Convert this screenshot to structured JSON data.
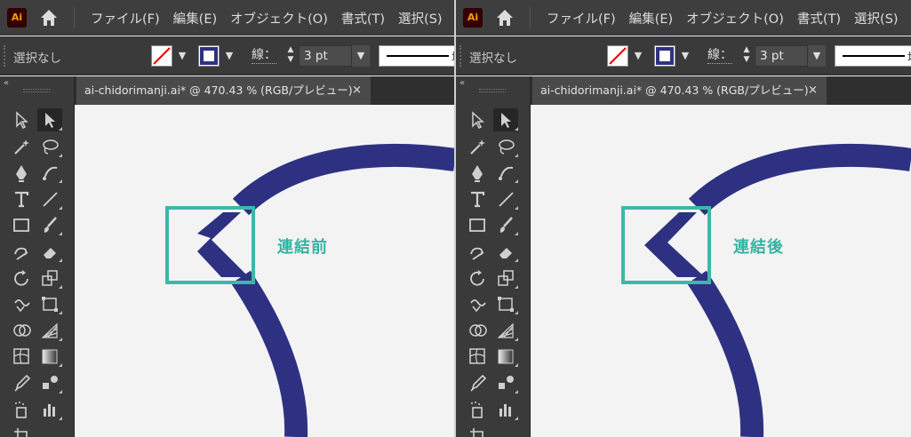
{
  "app": {
    "logo_text": "Ai"
  },
  "menu": [
    "ファイル(F)",
    "編集(E)",
    "オブジェクト(O)",
    "書式(T)",
    "選択(S)"
  ],
  "control": {
    "selection_label": "選択なし",
    "stroke_label": "線：",
    "stroke_weight": "3 pt",
    "profile_label": "均"
  },
  "document": {
    "tab_title": "ai-chidorimanji.ai* @ 470.43 % (RGB/プレビュー)",
    "close": "×"
  },
  "tools": [
    "direct-selection",
    "selection",
    "magic-wand",
    "lasso",
    "pen",
    "curvature",
    "type",
    "line-segment",
    "rectangle",
    "paintbrush",
    "shaper",
    "eraser",
    "rotate",
    "scale",
    "warp",
    "free-transform",
    "shape-builder",
    "perspective-grid",
    "mesh",
    "gradient",
    "eyedropper",
    "blend",
    "symbol-sprayer",
    "column-graph",
    "artboard"
  ],
  "colors": {
    "shape": "#2e3182",
    "highlight": "#3db7a8",
    "label": "#36b3a3"
  },
  "panels": [
    {
      "label": "連結前",
      "state": "before"
    },
    {
      "label": "連結後",
      "state": "after"
    }
  ]
}
